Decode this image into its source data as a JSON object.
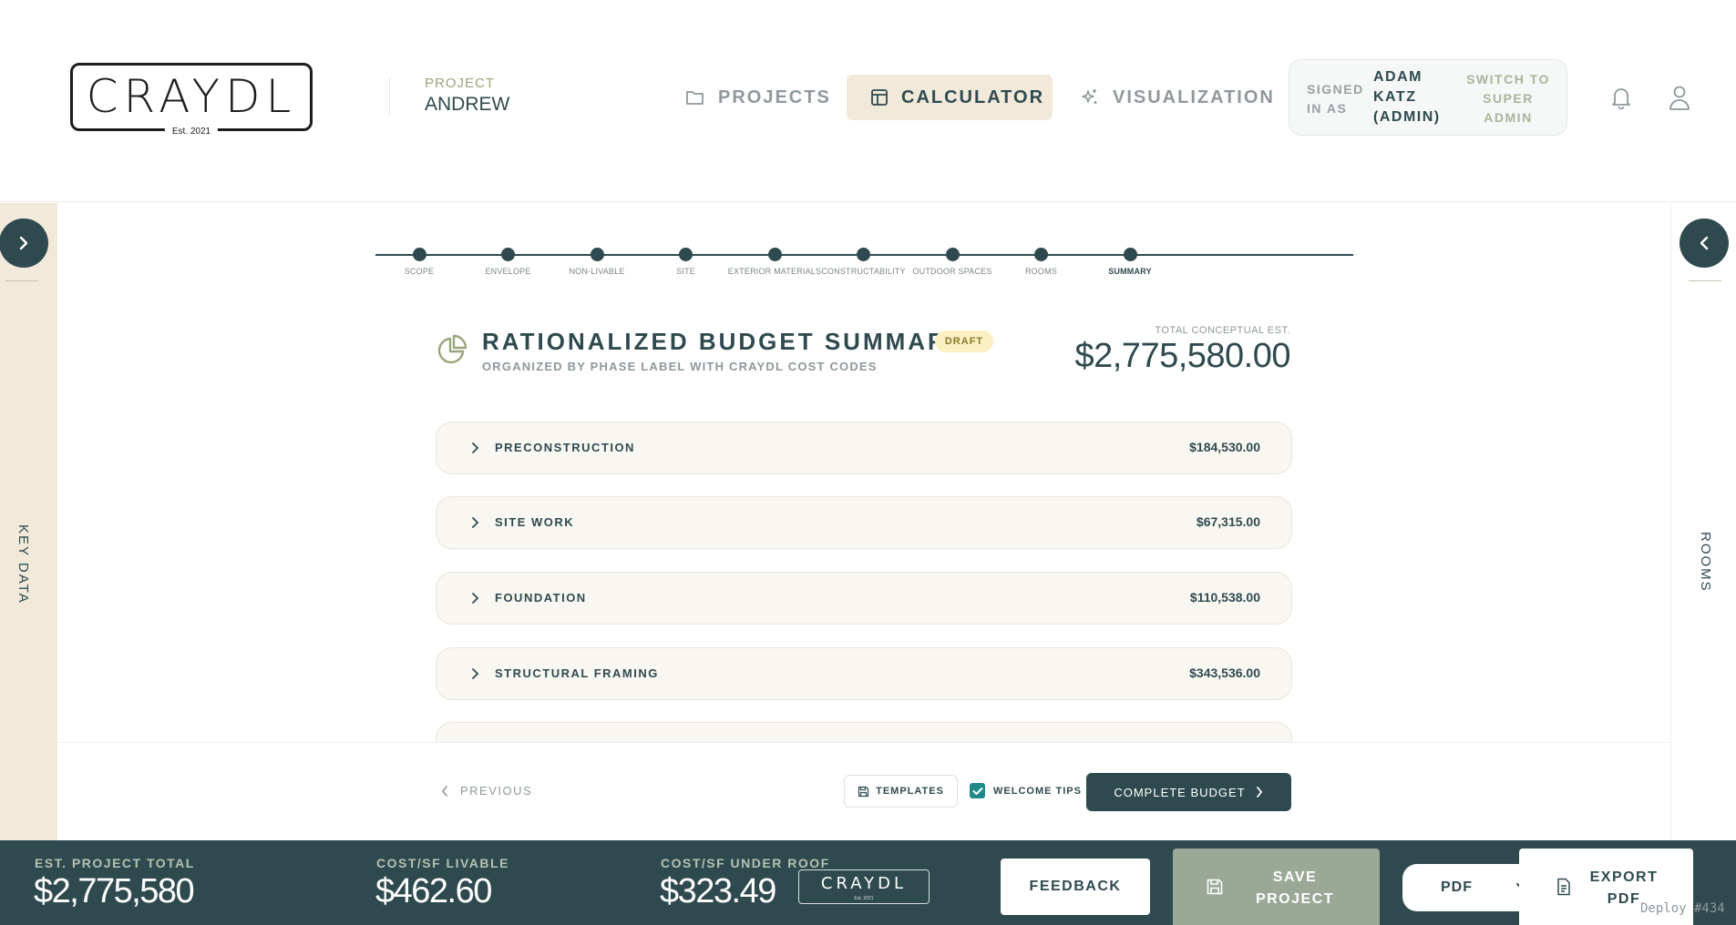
{
  "header": {
    "logo_text": "CRAYDL",
    "logo_est": "Est. 2021",
    "project_label": "PROJECT",
    "project_name": "ANDREW",
    "nav": {
      "projects": "PROJECTS",
      "calculator": "CALCULATOR",
      "visualization": "VISUALIZATION"
    },
    "signed_in_label": "SIGNED IN AS",
    "signed_in_user": "ADAM KATZ (ADMIN)",
    "switch_admin": "SWITCH TO SUPER ADMIN"
  },
  "side": {
    "left_label": "KEY DATA",
    "right_label": "ROOMS"
  },
  "stepper": {
    "steps": [
      "SCOPE",
      "ENVELOPE",
      "NON-LIVABLE",
      "SITE",
      "EXTERIOR MATERIALS",
      "CONSTRUCTABILITY",
      "OUTDOOR SPACES",
      "ROOMS",
      "SUMMARY"
    ],
    "active": "SUMMARY"
  },
  "summary": {
    "title": "RATIONALIZED BUDGET SUMMARY",
    "badge": "DRAFT",
    "subtitle": "ORGANIZED BY PHASE LABEL WITH CRAYDL COST CODES",
    "total_label": "TOTAL CONCEPTUAL EST.",
    "total_value": "$2,775,580.00"
  },
  "phases": [
    {
      "name": "PRECONSTRUCTION",
      "amount": "$184,530.00"
    },
    {
      "name": "SITE WORK",
      "amount": "$67,315.00"
    },
    {
      "name": "FOUNDATION",
      "amount": "$110,538.00"
    },
    {
      "name": "STRUCTURAL FRAMING",
      "amount": "$343,536.00"
    }
  ],
  "actions": {
    "previous": "PREVIOUS",
    "templates": "TEMPLATES",
    "welcome_tips": "WELCOME TIPS",
    "complete": "COMPLETE BUDGET"
  },
  "stats": {
    "total_label": "EST. PROJECT TOTAL",
    "total_value": "$2,775,580",
    "livable_label": "COST/SF LIVABLE",
    "livable_value": "$462.60",
    "roof_label": "COST/SF UNDER ROOF",
    "roof_value": "$323.49",
    "mini_logo": "CRAYDL",
    "mini_logo_est": "Est. 2021",
    "feedback": "FEEDBACK",
    "save": "SAVE PROJECT",
    "pdf_option": "PDF",
    "export": "EXPORT PDF",
    "deploy": "Deploy #434"
  },
  "colors": {
    "primary": "#2f4a4f",
    "accent_beige": "#f1e9da",
    "sage": "#9ba896",
    "check": "#1f8a8a"
  }
}
